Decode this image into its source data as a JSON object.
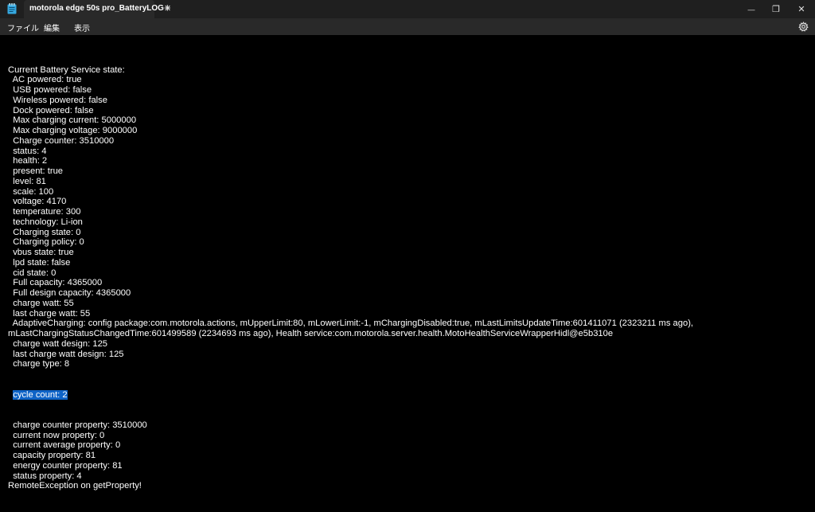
{
  "window": {
    "tab_title": "motorola edge 50s pro_BatteryLOG",
    "tab_close": "✕",
    "new_tab": "+",
    "minimize": "—",
    "restore": "❐",
    "close": "✕"
  },
  "menu": {
    "file": "ファイル",
    "edit": "編集",
    "view": "表示"
  },
  "log": {
    "lines": [
      "Current Battery Service state:",
      "  AC powered: true",
      "  USB powered: false",
      "  Wireless powered: false",
      "  Dock powered: false",
      "  Max charging current: 5000000",
      "  Max charging voltage: 9000000",
      "  Charge counter: 3510000",
      "  status: 4",
      "  health: 2",
      "  present: true",
      "  level: 81",
      "  scale: 100",
      "  voltage: 4170",
      "  temperature: 300",
      "  technology: Li-ion",
      "  Charging state: 0",
      "  Charging policy: 0",
      "  vbus state: true",
      "  lpd state: false",
      "  cid state: 0",
      "  Full capacity: 4365000",
      "  Full design capacity: 4365000",
      "  charge watt: 55",
      "  last charge watt: 55",
      "  AdaptiveCharging: config package:com.motorola.actions, mUpperLimit:80, mLowerLimit:-1, mChargingDisabled:true, mLastLimitsUpdateTime:601411071 (2323211 ms ago),",
      "mLastChargingStatusChangedTime:601499589 (2234693 ms ago), Health service:com.motorola.server.health.MotoHealthServiceWrapperHidl@e5b310e",
      "  charge watt design: 125",
      "  last charge watt design: 125",
      "  charge type: 8"
    ],
    "selected_indent": "  ",
    "selected_text": "cycle count: 2",
    "lines_after": [
      "  charge counter property: 3510000",
      "  current now property: 0",
      "  current average property: 0",
      "  capacity property: 81",
      "  energy counter property: 81",
      "  status property: 4",
      "RemoteException on getProperty!"
    ]
  },
  "colors": {
    "background": "#000000",
    "titlebar": "#1f1f1f",
    "menubar": "#292929",
    "selection": "#0e63c6",
    "icon_accent": "#35a8e0"
  },
  "icons": {
    "app": "notepad-icon",
    "settings": "gear-icon"
  }
}
